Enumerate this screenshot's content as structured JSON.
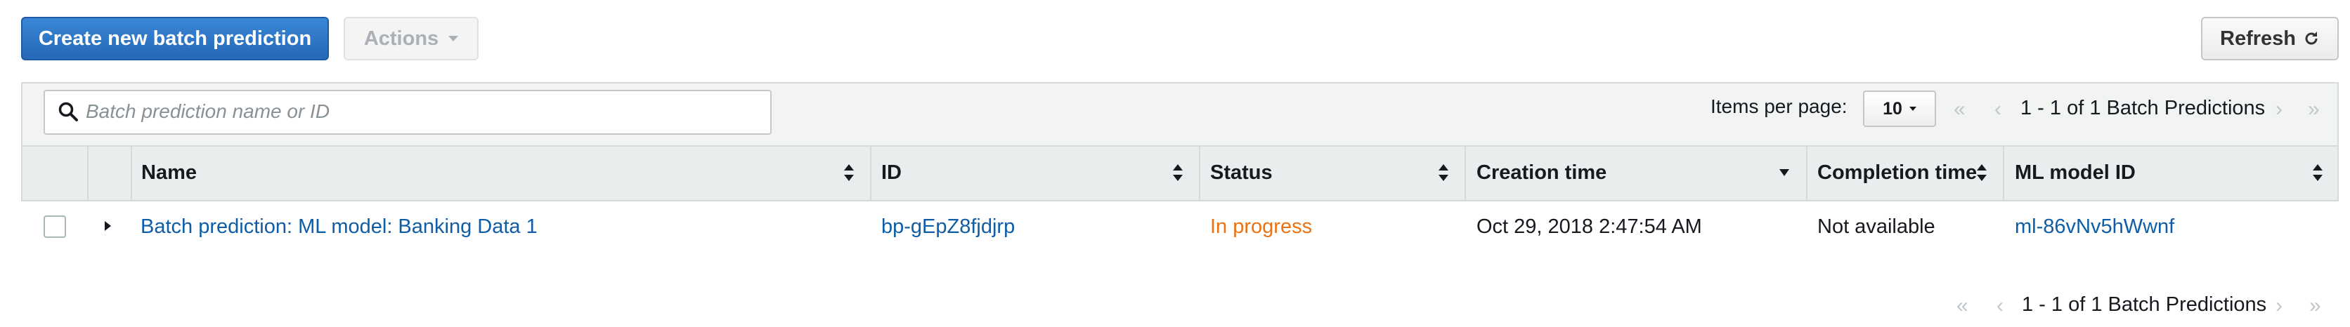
{
  "toolbar": {
    "create_label": "Create new batch prediction",
    "actions_label": "Actions",
    "refresh_label": "Refresh"
  },
  "filter": {
    "search_placeholder": "Batch prediction name or ID",
    "items_per_page_label": "Items per page:",
    "items_per_page_value": "10",
    "pagination_text": "1 - 1 of 1 Batch Predictions"
  },
  "table": {
    "columns": [
      "Name",
      "ID",
      "Status",
      "Creation time",
      "Completion time",
      "ML model ID"
    ],
    "rows": [
      {
        "name": "Batch prediction: ML model: Banking Data 1",
        "id": "bp-gEpZ8fjdjrp",
        "status": "In progress",
        "creation_time": "Oct 29, 2018 2:47:54 AM",
        "completion_time": "Not available",
        "ml_model_id": "ml-86vNv5hWwnf"
      }
    ]
  },
  "footer": {
    "pagination_text": "1 - 1 of 1 Batch Predictions"
  },
  "colors": {
    "primary": "#2569b8",
    "link": "#0e5da6",
    "status_in_progress": "#ec7211",
    "header_bg": "#eaeded"
  },
  "icons": {
    "search": "search-icon",
    "refresh": "refresh-icon",
    "sort": "sort-icon",
    "pager_first": "first-page-icon",
    "pager_prev": "prev-page-icon",
    "pager_next": "next-page-icon",
    "pager_last": "last-page-icon"
  }
}
